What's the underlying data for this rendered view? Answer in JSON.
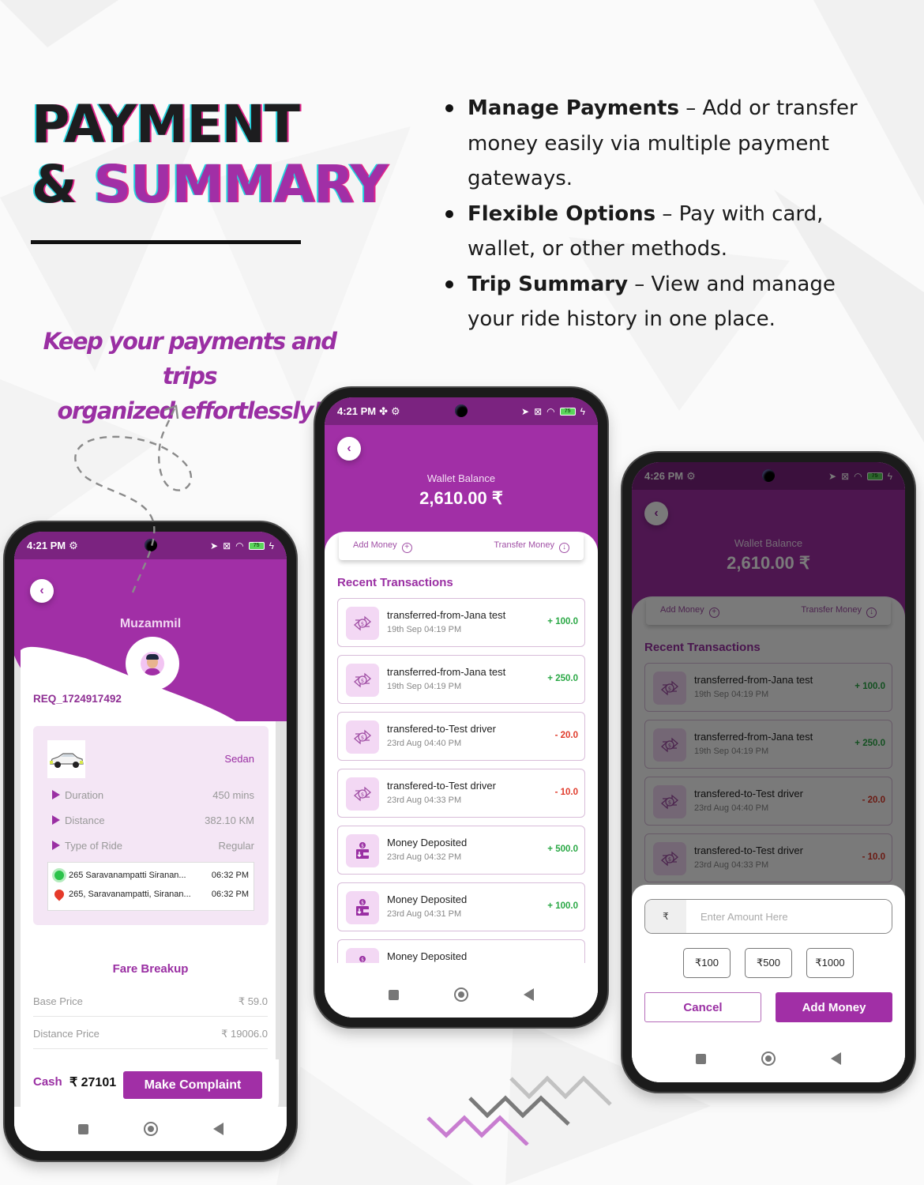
{
  "headline": {
    "line1": "PAYMENT",
    "amp": "& ",
    "line2": "SUMMARY"
  },
  "tagline": {
    "line1": "Keep your payments and trips",
    "line2": "organized effortlessly!"
  },
  "features": [
    {
      "title": "Manage Payments",
      "text": " – Add or transfer money easily via multiple payment gateways."
    },
    {
      "title": "Flexible Options",
      "text": " – Pay with card, wallet, or other methods."
    },
    {
      "title": "Trip Summary",
      "text": " – View and manage your ride history in one place."
    }
  ],
  "colors": {
    "brand": "#a12fa6",
    "positive": "#2aa845",
    "negative": "#e03a2a"
  },
  "trip_screen": {
    "status": {
      "time": "4:21 PM",
      "battery": "75"
    },
    "rider_name": "Muzammil",
    "request_id": "REQ_1724917492",
    "vehicle_type": "Sedan",
    "details": [
      {
        "label": "Duration",
        "value": "450 mins"
      },
      {
        "label": "Distance",
        "value": "382.10 KM"
      },
      {
        "label": "Type of Ride",
        "value": "Regular"
      }
    ],
    "pickup": {
      "address": "265 Saravanampatti Siranan...",
      "time": "06:32 PM"
    },
    "drop": {
      "address": "265, Saravanampatti, Siranan...",
      "time": "06:32 PM"
    },
    "fare_title": "Fare Breakup",
    "fare": [
      {
        "label": "Base Price",
        "value": "₹ 59.0"
      },
      {
        "label": "Distance Price",
        "value": "₹ 19006.0"
      }
    ],
    "payment_method": "Cash",
    "total": "₹ 27101",
    "complaint_label": "Make Complaint"
  },
  "wallet_screen": {
    "status": {
      "time": "4:21 PM",
      "battery": "75"
    },
    "balance_label": "Wallet Balance",
    "balance": "2,610.00 ₹",
    "add_money": "Add Money",
    "transfer_money": "Transfer Money",
    "recent_title": "Recent Transactions",
    "transactions": [
      {
        "title": "transferred-from-Jana test",
        "date": "19th Sep 04:19 PM",
        "amount": "+ 100.0",
        "type": "transfer",
        "sign": "pos"
      },
      {
        "title": "transferred-from-Jana test",
        "date": "19th Sep 04:19 PM",
        "amount": "+ 250.0",
        "type": "transfer",
        "sign": "pos"
      },
      {
        "title": "transfered-to-Test driver",
        "date": "23rd Aug 04:40 PM",
        "amount": "- 20.0",
        "type": "transfer",
        "sign": "neg"
      },
      {
        "title": "transfered-to-Test driver",
        "date": "23rd Aug 04:33 PM",
        "amount": "- 10.0",
        "type": "transfer",
        "sign": "neg"
      },
      {
        "title": "Money Deposited",
        "date": "23rd Aug 04:32 PM",
        "amount": "+ 500.0",
        "type": "deposit",
        "sign": "pos"
      },
      {
        "title": "Money Deposited",
        "date": "23rd Aug 04:31 PM",
        "amount": "+ 100.0",
        "type": "deposit",
        "sign": "pos"
      },
      {
        "title": "Money Deposited",
        "date": "",
        "amount": "",
        "type": "deposit",
        "sign": "pos"
      }
    ]
  },
  "add_money_screen": {
    "status": {
      "time": "4:26 PM",
      "battery": "75"
    },
    "balance_label": "Wallet Balance",
    "balance": "2,610.00 ₹",
    "add_money": "Add Money",
    "transfer_money": "Transfer Money",
    "recent_title": "Recent Transactions",
    "transactions": [
      {
        "title": "transferred-from-Jana test",
        "date": "19th Sep 04:19 PM",
        "amount": "+ 100.0",
        "sign": "pos"
      },
      {
        "title": "transferred-from-Jana test",
        "date": "19th Sep 04:19 PM",
        "amount": "+ 250.0",
        "sign": "pos"
      },
      {
        "title": "transfered-to-Test driver",
        "date": "23rd Aug 04:40 PM",
        "amount": "- 20.0",
        "sign": "neg"
      },
      {
        "title": "transfered-to-Test driver",
        "date": "23rd Aug 04:33 PM",
        "amount": "- 10.0",
        "sign": "neg"
      }
    ],
    "currency_symbol": "₹",
    "amount_placeholder": "Enter Amount Here",
    "quick_amounts": [
      "₹100",
      "₹500",
      "₹1000"
    ],
    "cancel_label": "Cancel",
    "confirm_label": "Add Money"
  }
}
